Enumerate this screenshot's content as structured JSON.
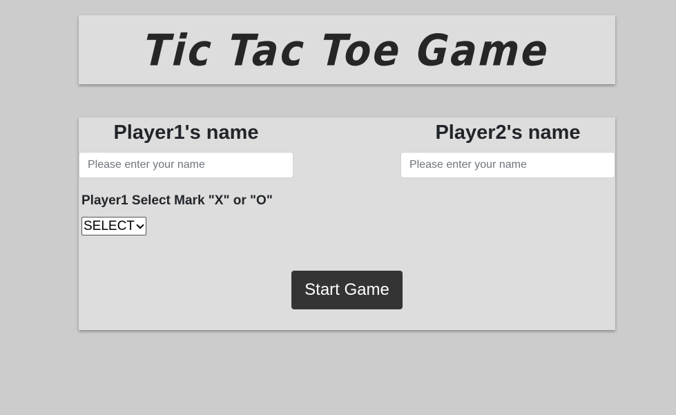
{
  "header": {
    "title": "Tic Tac Toe Game"
  },
  "players": {
    "player1": {
      "heading": "Player1's name",
      "placeholder": "Please enter your name",
      "value": ""
    },
    "player2": {
      "heading": "Player2's name",
      "placeholder": "Please enter your name",
      "value": ""
    }
  },
  "mark": {
    "label": "Player1 Select Mark \"X\" or \"O\"",
    "selected": "SELECT"
  },
  "actions": {
    "start_label": "Start Game"
  },
  "colors": {
    "page_background": "#cccccc",
    "panel_background": "#dddddd",
    "button_background": "#343434",
    "text": "#212529"
  }
}
